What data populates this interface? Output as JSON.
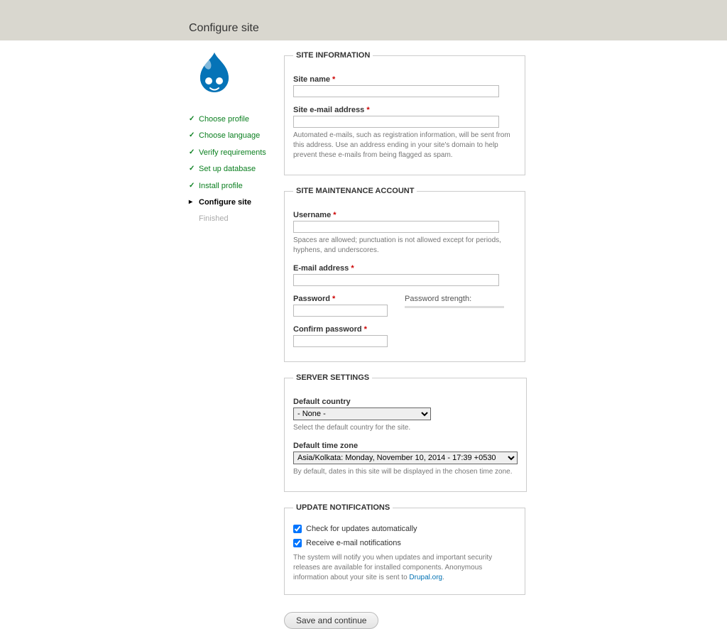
{
  "page_title": "Configure site",
  "steps": [
    {
      "label": "Choose profile",
      "state": "done"
    },
    {
      "label": "Choose language",
      "state": "done"
    },
    {
      "label": "Verify requirements",
      "state": "done"
    },
    {
      "label": "Set up database",
      "state": "done"
    },
    {
      "label": "Install profile",
      "state": "done"
    },
    {
      "label": "Configure site",
      "state": "active"
    },
    {
      "label": "Finished",
      "state": "pending"
    }
  ],
  "site_info": {
    "legend": "SITE INFORMATION",
    "site_name_label": "Site name",
    "site_name_value": "",
    "email_label": "Site e-mail address",
    "email_value": "",
    "email_desc": "Automated e-mails, such as registration information, will be sent from this address. Use an address ending in your site's domain to help prevent these e-mails from being flagged as spam."
  },
  "maint": {
    "legend": "SITE MAINTENANCE ACCOUNT",
    "username_label": "Username",
    "username_value": "",
    "username_desc": "Spaces are allowed; punctuation is not allowed except for periods, hyphens, and underscores.",
    "email_label": "E-mail address",
    "email_value": "",
    "password_label": "Password",
    "password_value": "",
    "strength_label": "Password strength:",
    "confirm_label": "Confirm password",
    "confirm_value": ""
  },
  "server": {
    "legend": "SERVER SETTINGS",
    "country_label": "Default country",
    "country_value": "- None -",
    "country_desc": "Select the default country for the site.",
    "tz_label": "Default time zone",
    "tz_value": "Asia/Kolkata: Monday, November 10, 2014 - 17:39 +0530",
    "tz_desc": "By default, dates in this site will be displayed in the chosen time zone."
  },
  "updates": {
    "legend": "UPDATE NOTIFICATIONS",
    "check_label": "Check for updates automatically",
    "check_checked": true,
    "receive_label": "Receive e-mail notifications",
    "receive_checked": true,
    "desc_pre": "The system will notify you when updates and important security releases are available for installed components. Anonymous information about your site is sent to ",
    "desc_link": "Drupal.org",
    "desc_post": "."
  },
  "submit_label": "Save and continue"
}
